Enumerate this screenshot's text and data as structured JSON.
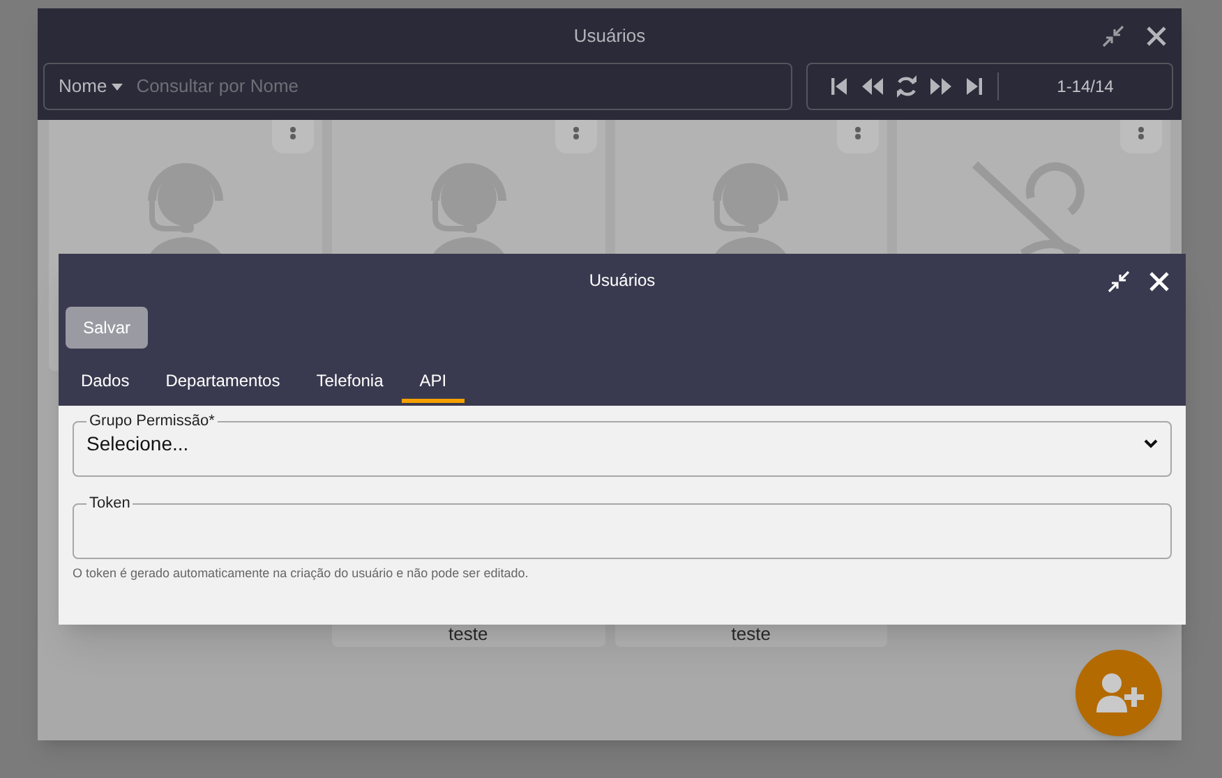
{
  "background_window": {
    "title": "Usuários",
    "search": {
      "filter": "Nome",
      "placeholder": "Consultar por Nome"
    },
    "pagination": {
      "range": "1-14/14"
    },
    "top_cards": [
      {
        "kind": "agent"
      },
      {
        "kind": "agent"
      },
      {
        "kind": "agent"
      },
      {
        "kind": "disabled"
      }
    ],
    "bottom_cards": [
      {
        "kind": "empty"
      },
      {
        "kind": "named",
        "name": "teste"
      },
      {
        "kind": "named",
        "name": "teste"
      }
    ]
  },
  "dialog": {
    "title": "Usuários",
    "save_button": "Salvar",
    "tabs": [
      {
        "label": "Dados",
        "selected": false
      },
      {
        "label": "Departamentos",
        "selected": false
      },
      {
        "label": "Telefonia",
        "selected": false
      },
      {
        "label": "API",
        "selected": true
      }
    ],
    "fields": [
      {
        "kind": "select",
        "label": "Grupo Permissão*",
        "value": "Selecione..."
      },
      {
        "kind": "text",
        "label": "Token"
      }
    ],
    "help_text": "O token é gerado automaticamente na criação do usuário e não pode ser editado."
  }
}
